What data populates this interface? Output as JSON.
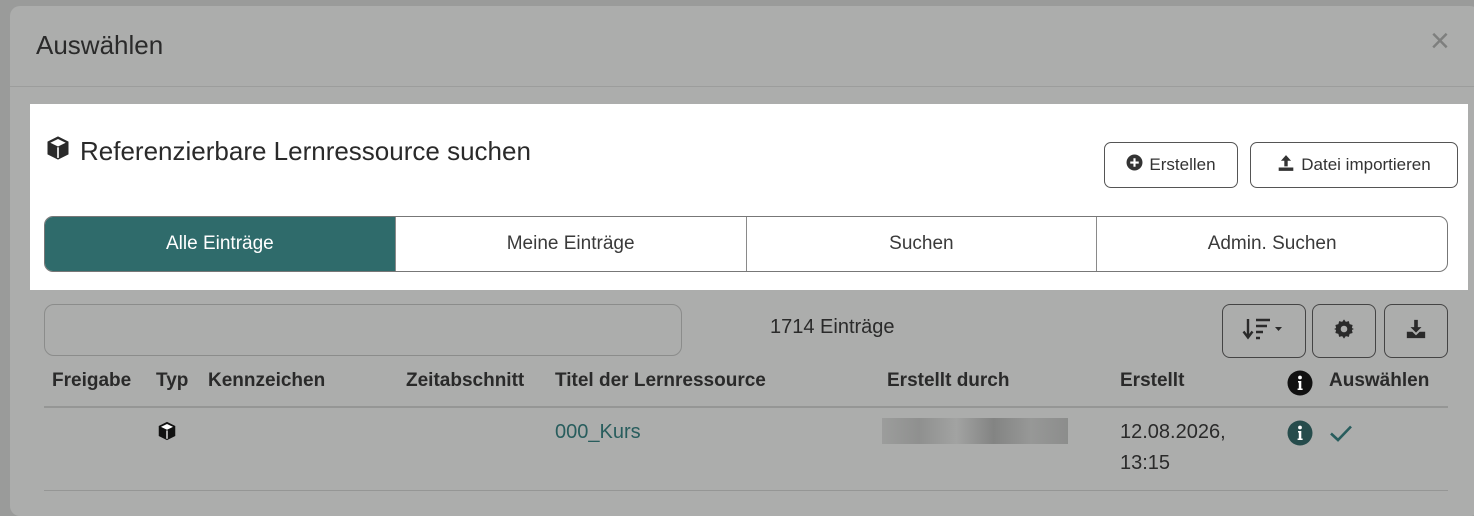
{
  "dialog": {
    "title": "Auswählen",
    "close_symbol": "×"
  },
  "panel": {
    "heading": "Referenzierbare Lernressource suchen",
    "heading_icon": "cube-icon",
    "create_label": "Erstellen",
    "import_label": "Datei importieren"
  },
  "tabs": [
    {
      "label": "Alle Einträge",
      "active": true
    },
    {
      "label": "Meine Einträge",
      "active": false
    },
    {
      "label": "Suchen",
      "active": false
    },
    {
      "label": "Admin. Suchen",
      "active": false
    }
  ],
  "toolbar": {
    "search_value": "",
    "count_text": "1714 Einträge",
    "icons": [
      "sort-icon",
      "gear-icon",
      "download-icon"
    ]
  },
  "table": {
    "columns": [
      "Freigabe",
      "Typ",
      "Kennzeichen",
      "Zeitabschnitt",
      "Titel der Lernressource",
      "Erstellt durch",
      "Erstellt",
      "Auswählen"
    ],
    "rows": [
      {
        "freigabe": "",
        "typ_icon": "cube-icon",
        "kennzeichen": "",
        "zeitabschnitt": "",
        "titel": "000_Kurs",
        "erstellt_durch": "",
        "erstellt_line1": "12.08.2026,",
        "erstellt_line2": "13:15"
      }
    ]
  },
  "colors": {
    "accent": "#2f6b6b",
    "link": "#285d5d",
    "overlay_gray": "#acadac"
  }
}
